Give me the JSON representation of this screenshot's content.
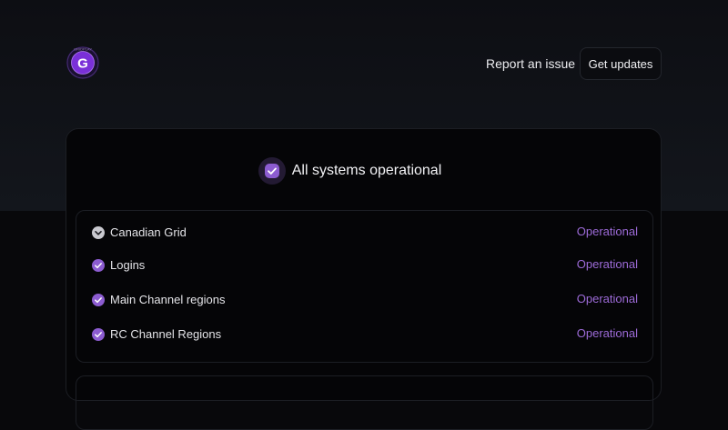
{
  "header": {
    "logo_letter": "G",
    "logo_ring_text": "GRIDPLAY",
    "report_link": "Report an issue",
    "updates_button": "Get updates"
  },
  "summary": {
    "text": "All systems operational",
    "icon": "check-circle-icon"
  },
  "components": [
    {
      "name": "Canadian Grid",
      "status": "Operational",
      "icon": "chevron-down-icon",
      "expandable": true
    },
    {
      "name": "Logins",
      "status": "Operational",
      "icon": "check-circle-icon"
    },
    {
      "name": "Main Channel regions",
      "status": "Operational",
      "icon": "check-circle-icon"
    },
    {
      "name": "RC Channel Regions",
      "status": "Operational",
      "icon": "check-circle-icon"
    }
  ],
  "colors": {
    "accent": "#9d6bd8",
    "check_fill": "#8c5cd0",
    "chevron_fill": "#c9c9cf",
    "background": "#08080b"
  }
}
